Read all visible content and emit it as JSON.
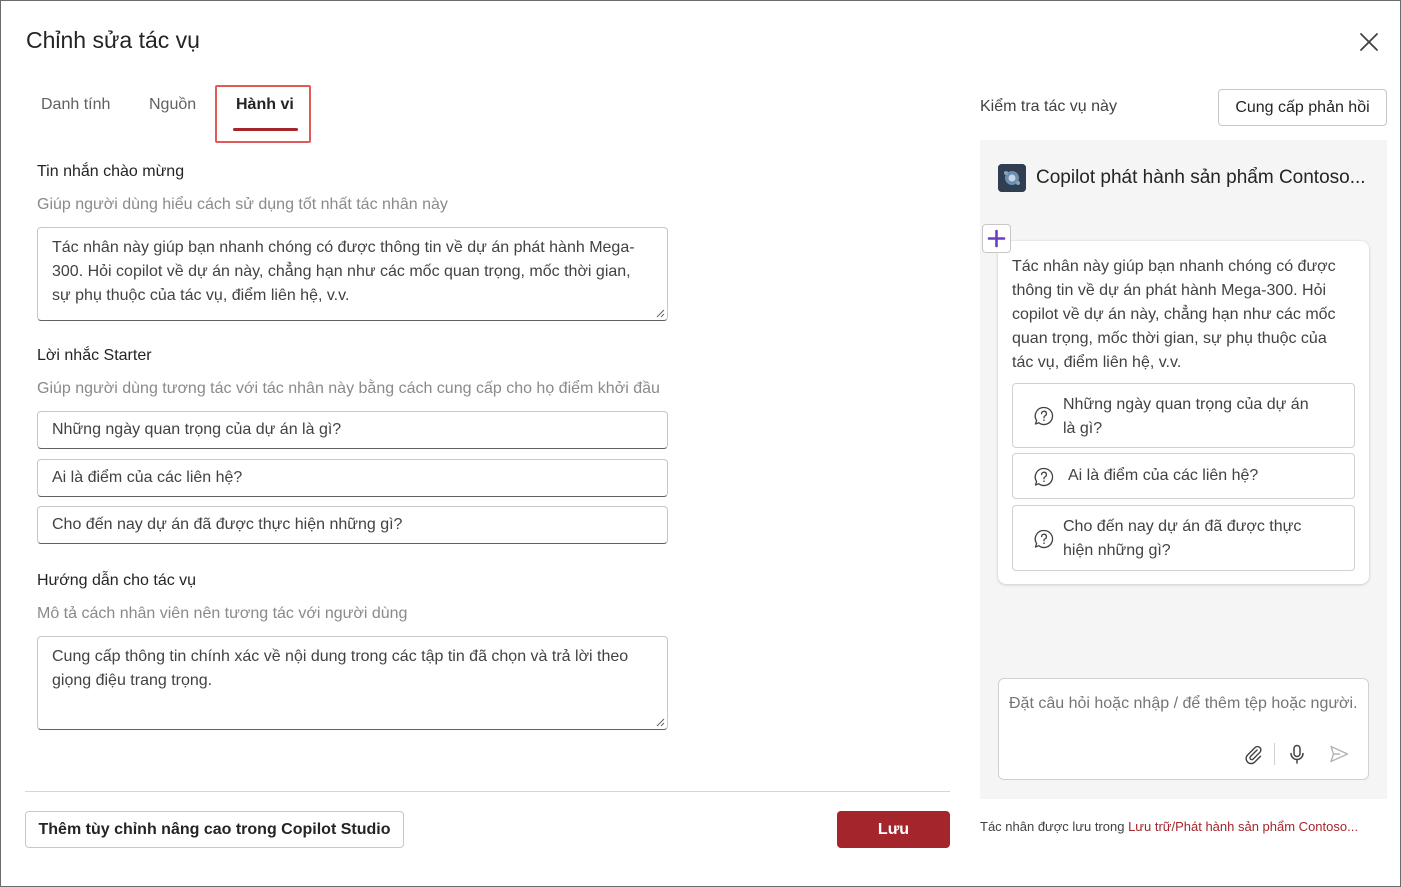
{
  "dialog": {
    "title": "Chỉnh sửa tác vụ"
  },
  "tabs": [
    {
      "label": "Danh tính"
    },
    {
      "label": "Nguồn"
    },
    {
      "label": "Hành vi"
    }
  ],
  "welcome": {
    "label": "Tin nhắn chào mừng",
    "help": "Giúp người dùng hiểu cách sử dụng tốt nhất tác nhân này",
    "value": "Tác nhân này giúp bạn nhanh chóng có được thông tin về dự án phát hành Mega-300. Hỏi copilot về dự án này, chẳng hạn như các mốc quan trọng, mốc thời gian, sự phụ thuộc của tác vụ, điểm liên hệ, v.v."
  },
  "starters": {
    "label": "Lời nhắc Starter",
    "help": "Giúp người dùng tương tác với tác nhân này bằng cách cung cấp cho họ điểm khởi đầu",
    "items": [
      "Những ngày quan trọng của dự án là gì?",
      "Ai là điểm của các liên hệ?",
      "Cho đến nay dự án đã được thực hiện những gì?"
    ]
  },
  "instructions": {
    "label": "Hướng dẫn cho tác vụ",
    "help": "Mô tả cách nhân viên nên tương tác với người dùng",
    "value": "Cung cấp thông tin chính xác về nội dung trong các tập tin đã chọn và trả lời theo giọng điệu trang trọng."
  },
  "footer": {
    "advanced_label": "Thêm tùy chỉnh nâng cao trong Copilot Studio",
    "save_label": "Lưu"
  },
  "preview": {
    "test_label": "Kiểm tra tác vụ này",
    "feedback_label": "Cung cấp phản hồi",
    "agent_name": "Copilot phát hành sản phẩm Contoso...",
    "message": "Tác nhân này giúp bạn nhanh chóng có được thông tin về dự án phát hành Mega-300. Hỏi copilot về dự án này, chẳng hạn như các mốc quan trọng, mốc thời gian, sự phụ thuộc của tác vụ, điểm liên hệ, v.v.",
    "suggestions": [
      "Những ngày quan trọng của dự án là gì?",
      "Ai là điểm của các liên hệ?",
      "Cho đến nay dự án đã được thực hiện những gì?"
    ],
    "composer_placeholder": "Đặt câu hỏi hoặc nhập / để thêm tệp hoặc người."
  },
  "save_note": {
    "prefix": "Tác nhân được lưu trong ",
    "link": "Lưu trữ/Phát hành sản phẩm Contoso..."
  },
  "colors": {
    "accent": "#a4262c",
    "highlight_box": "#e05a5a",
    "panel_bg": "#f5f5f5"
  }
}
